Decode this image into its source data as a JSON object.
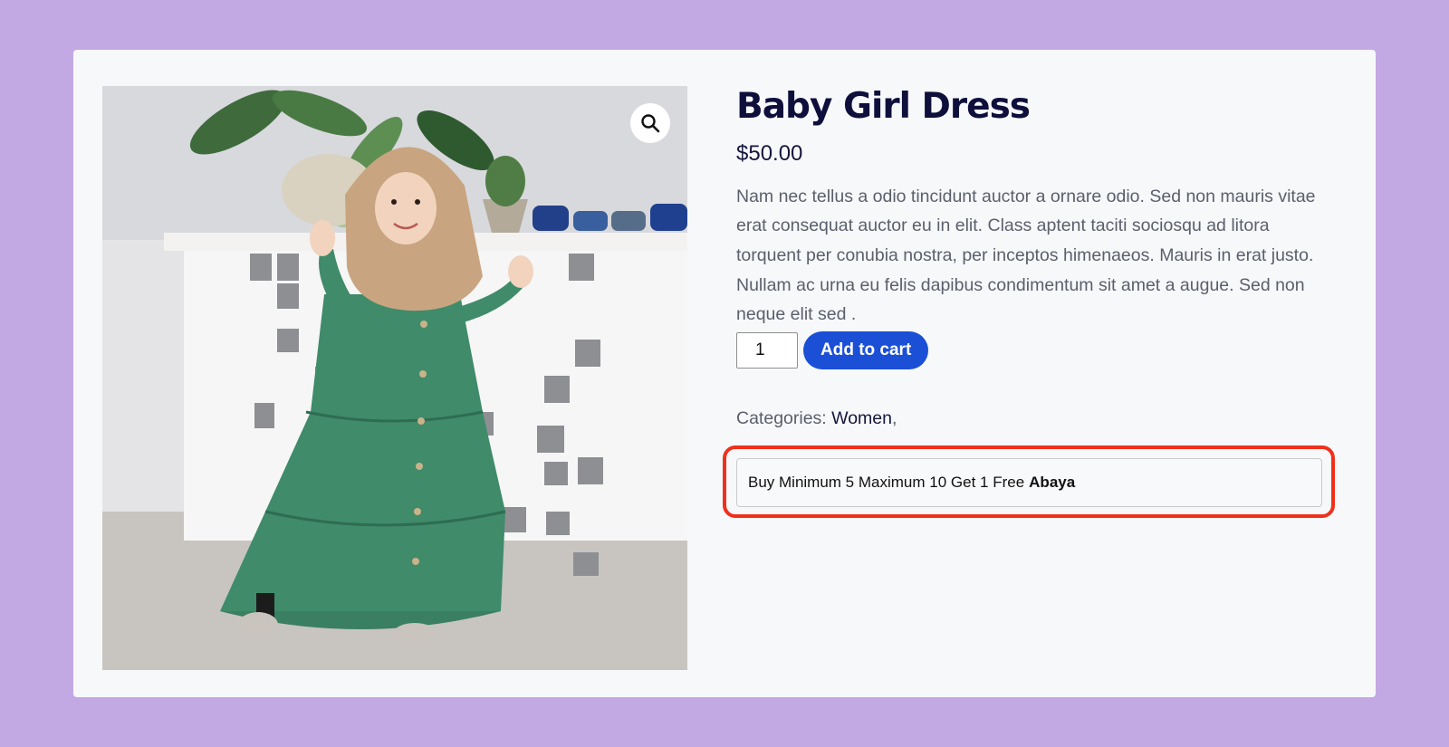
{
  "product": {
    "title": "Baby Girl Dress",
    "price": "$50.00",
    "description": "Nam nec tellus a odio tincidunt auctor a ornare odio. Sed non mauris vitae erat consequat auctor eu in elit. Class aptent taciti sociosqu ad litora torquent per conubia nostra, per inceptos himenaeos. Mauris in erat justo. Nullam ac urna eu felis dapibus condimentum sit amet a augue. Sed non neque elit sed ."
  },
  "cart": {
    "quantity": "1",
    "add_label": "Add to cart"
  },
  "categories": {
    "label": "Categories:",
    "items": [
      "Women"
    ],
    "separator": ","
  },
  "offer": {
    "text": "Buy Minimum 5 Maximum 10 Get 1 Free",
    "product": "Abaya"
  },
  "icons": {
    "zoom": "magnifier-icon"
  },
  "colors": {
    "page_background": "#c3a9e3",
    "card_background": "#f7f8fa",
    "title": "#0f0f3c",
    "button": "#1b4fd6",
    "highlight": "#f0301c"
  }
}
